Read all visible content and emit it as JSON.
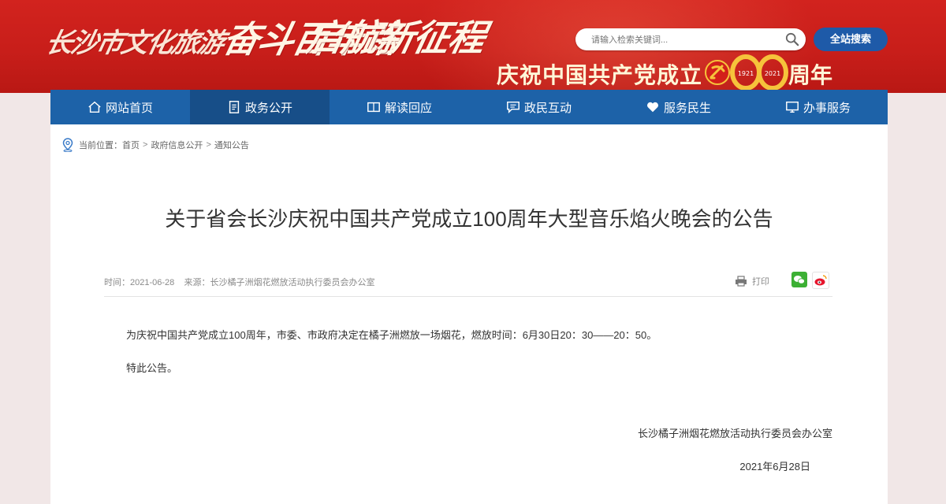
{
  "banner": {
    "calligraphy_line1_a": "长沙市文化旅游",
    "calligraphy_main_a": "奋斗百年路",
    "calligraphy_line1_b": "广电局",
    "calligraphy_main_b": "启航新征程",
    "celebrate_text": "庆祝中国共产党成立",
    "badge_number": "100",
    "badge_years_left": "1921",
    "badge_years_right": "2021",
    "celebrate_tail": "周年",
    "primary_color": "#c81e1a"
  },
  "search": {
    "placeholder": "请输入检索关键词...",
    "button_label": "全站搜索"
  },
  "nav": {
    "items": [
      {
        "label": "网站首页",
        "icon": "home-icon"
      },
      {
        "label": "政务公开",
        "icon": "document-icon"
      },
      {
        "label": "解读回应",
        "icon": "book-icon"
      },
      {
        "label": "政民互动",
        "icon": "chat-icon"
      },
      {
        "label": "服务民生",
        "icon": "heart-hand-icon"
      },
      {
        "label": "办事服务",
        "icon": "monitor-icon"
      }
    ],
    "active_index": 1,
    "color": "#1d62a8"
  },
  "breadcrumb": {
    "prefix": "当前位置：",
    "items": [
      "首页",
      "政府信息公开",
      "通知公告"
    ]
  },
  "article": {
    "title": "关于省会长沙庆祝中国共产党成立100周年大型音乐焰火晚会的公告",
    "meta_time_label": "时间：",
    "meta_time": "2021-06-28",
    "meta_source_label": "来源：",
    "meta_source": "长沙橘子洲烟花燃放活动执行委员会办公室",
    "print_label": "打印",
    "paragraphs": [
      "为庆祝中国共产党成立100周年，市委、市政府决定在橘子洲燃放一场烟花，燃放时间：6月30日20：30——20：50。",
      "特此公告。"
    ],
    "signature": "长沙橘子洲烟花燃放活动执行委员会办公室",
    "sign_date": "2021年6月28日"
  }
}
